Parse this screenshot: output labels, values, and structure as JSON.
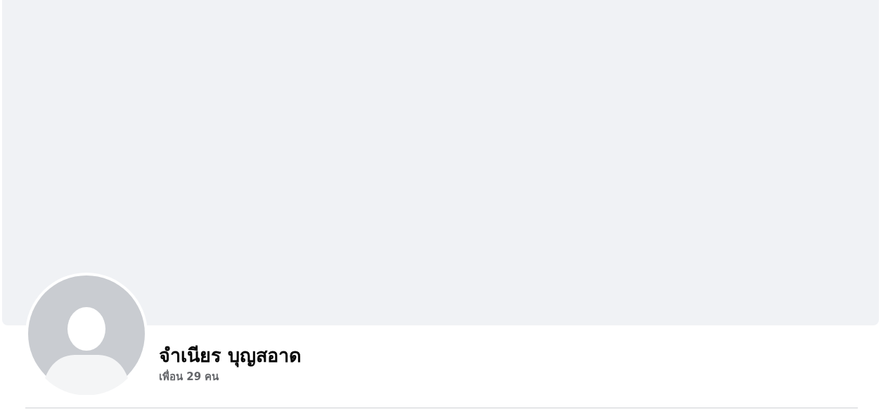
{
  "profile": {
    "name": "จำเนียร บุญสอาด",
    "friends": "เพื่อน 29 คน"
  }
}
